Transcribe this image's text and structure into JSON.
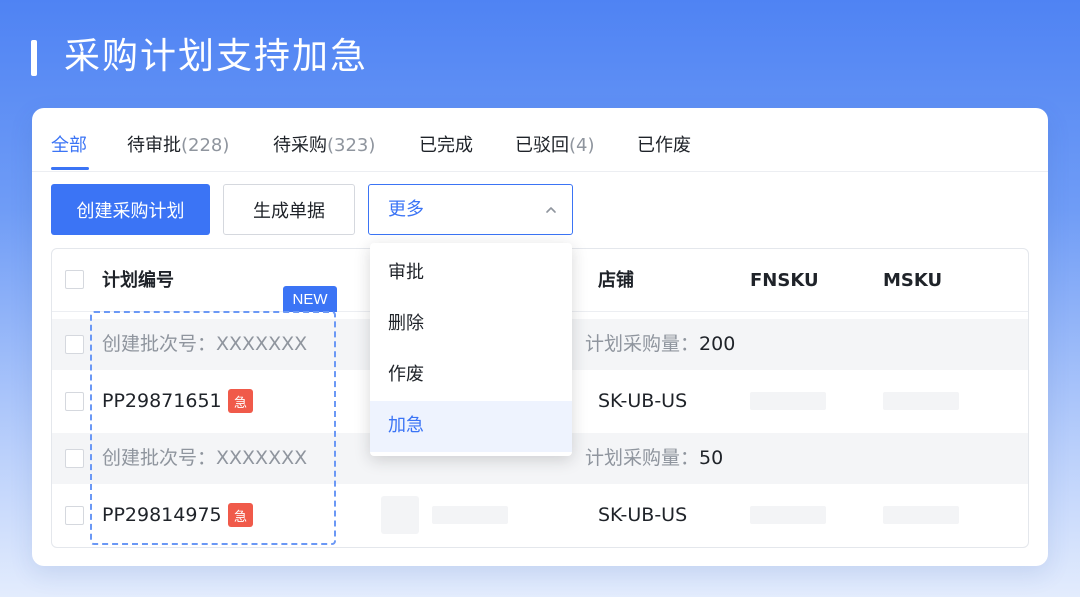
{
  "hero": {
    "title": "采购计划支持加急"
  },
  "tabs": [
    {
      "label": "全部",
      "count": ""
    },
    {
      "label": "待审批",
      "count": "(228)"
    },
    {
      "label": "待采购",
      "count": "(323)"
    },
    {
      "label": "已完成",
      "count": ""
    },
    {
      "label": "已驳回",
      "count": "(4)"
    },
    {
      "label": "已作废",
      "count": ""
    }
  ],
  "toolbar": {
    "create_label": "创建采购计划",
    "generate_label": "生成单据",
    "more_label": "更多"
  },
  "dropdown": {
    "items": [
      "审批",
      "删除",
      "作废",
      "加急"
    ],
    "active_index": 3
  },
  "table": {
    "headers": {
      "plan_no": "计划编号",
      "store": "店铺",
      "fnsku": "FNSKU",
      "msku": "MSKU"
    },
    "new_badge": "NEW",
    "urgent_label": "急",
    "rows": [
      {
        "batch": "创建批次号：XXXXXXX",
        "qty_label": "计划采购量：",
        "qty": "200",
        "plan_no": "PP29871651",
        "store": "SK-UB-US"
      },
      {
        "batch": "创建批次号：XXXXXXX",
        "qty_label": "计划采购量：",
        "qty": "50",
        "plan_no": "PP29814975",
        "store": "SK-UB-US"
      }
    ]
  },
  "colors": {
    "accent": "#3b74f5",
    "urgent": "#f05a4a",
    "hero_top": "#4f83f3"
  }
}
